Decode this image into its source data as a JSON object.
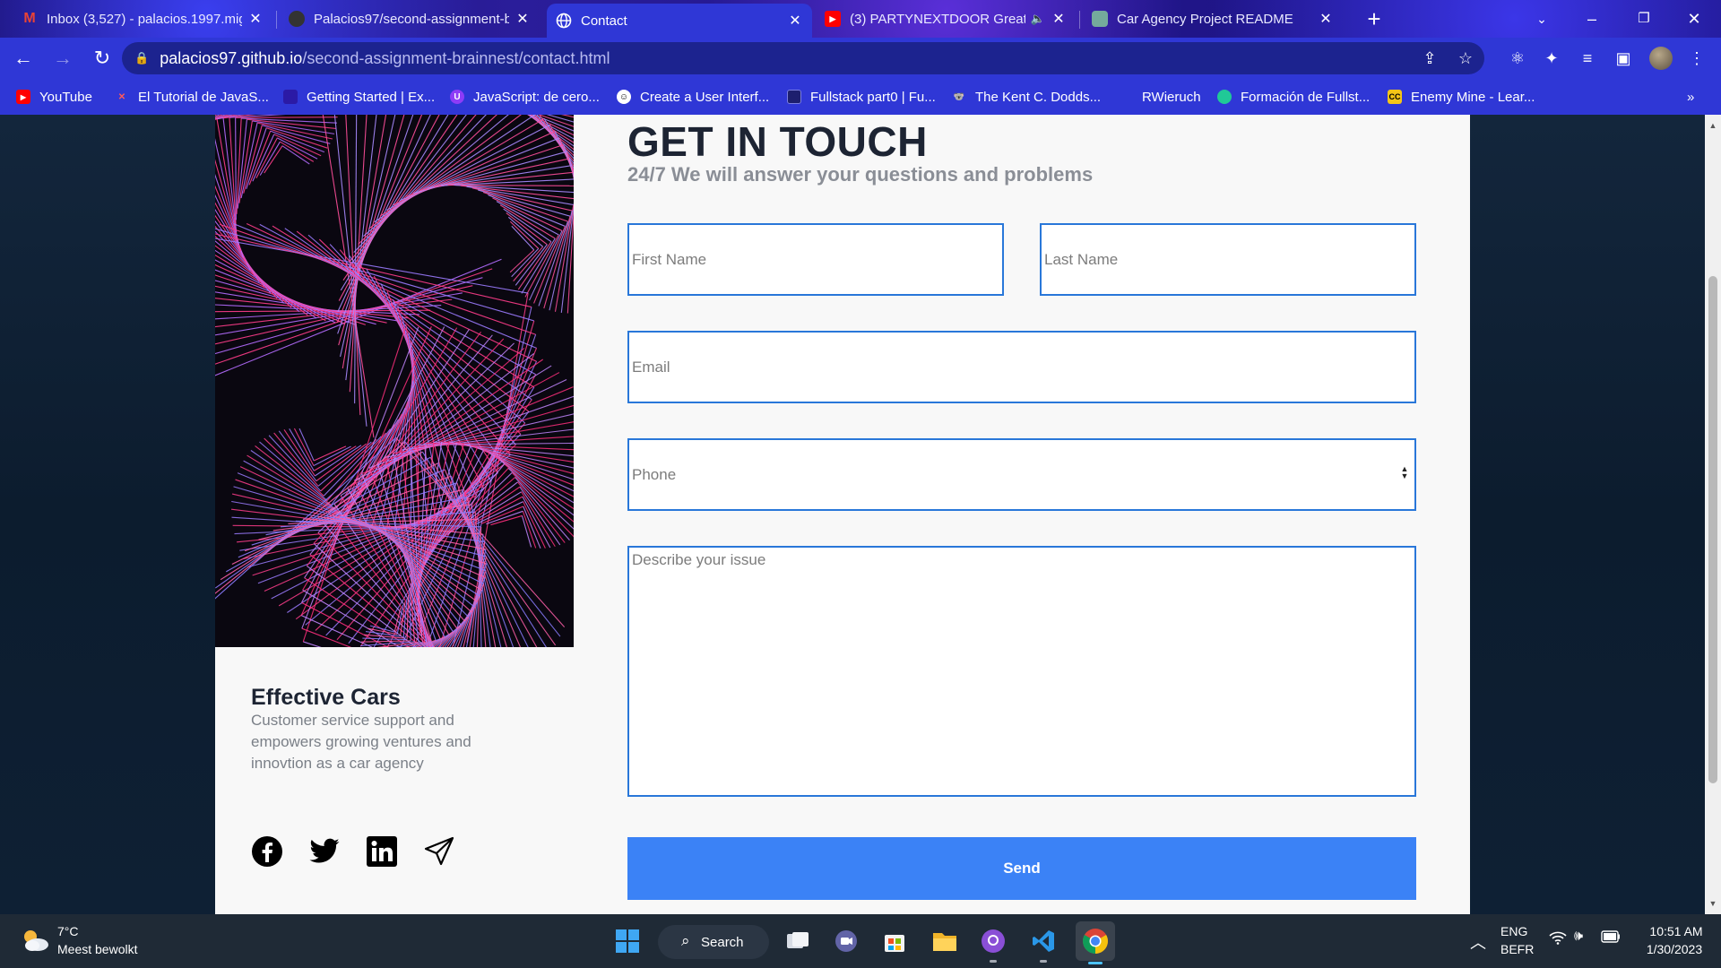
{
  "browser": {
    "tabs": [
      {
        "title": "Inbox (3,527) - palacios.1997.mig",
        "icon": "gmail-icon"
      },
      {
        "title": "Palacios97/second-assignment-b",
        "icon": "github-icon"
      },
      {
        "title": "Contact",
        "icon": "globe-icon",
        "active": true
      },
      {
        "title": "(3) PARTYNEXTDOOR Greate",
        "icon": "youtube-icon"
      },
      {
        "title": "Car Agency Project README",
        "icon": "chatgpt-icon"
      }
    ],
    "url_host": "palacios97.github.io",
    "url_path": "/second-assignment-brainnest/contact.html",
    "bookmarks": [
      "YouTube",
      "El Tutorial de JavaS...",
      "Getting Started | Ex...",
      "JavaScript: de cero...",
      "Create a User Interf...",
      "Fullstack part0 | Fu...",
      "The Kent C. Dodds...",
      "RWieruch",
      "Formación de Fullst...",
      "Enemy Mine - Lear..."
    ],
    "bookmarks_more": "»"
  },
  "page": {
    "title": "GET IN TOUCH",
    "subtitle": "24/7 We will answer your questions and problems",
    "brand_name": "Effective Cars",
    "brand_description": "Customer service support and empowers growing ventures and innovtion as a car agency",
    "form": {
      "first_name_placeholder": "First Name",
      "last_name_placeholder": "Last Name",
      "email_placeholder": "Email",
      "phone_placeholder": "Phone",
      "issue_placeholder": "Describe your issue",
      "send_label": "Send"
    },
    "accent_color": "#3b82f6",
    "border_color": "#2977d9"
  },
  "taskbar": {
    "weather_temp": "7°C",
    "weather_desc": "Meest bewolkt",
    "search_label": "Search",
    "lang_top": "ENG",
    "lang_bottom": "BEFR",
    "time": "10:51 AM",
    "date": "1/30/2023"
  }
}
